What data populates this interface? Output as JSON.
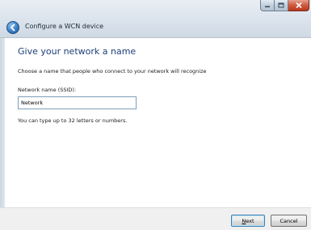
{
  "window": {
    "title": "Configure a WCN device",
    "caption_buttons": [
      "minimize-icon",
      "maximize-icon",
      "close-icon"
    ]
  },
  "page": {
    "heading": "Give your network a name",
    "instruction": "Choose a name that people who connect to your network will recognize",
    "field_label": "Network name (SSID):",
    "field_value": "Network",
    "hint": "You can type up to 32 letters or numbers."
  },
  "buttons": {
    "next_accel": "N",
    "next_rest": "ext",
    "cancel": "Cancel"
  },
  "colors": {
    "heading": "#1c3e78",
    "close_button": "#cf5a3f",
    "back_button": "#3a7fc4"
  }
}
